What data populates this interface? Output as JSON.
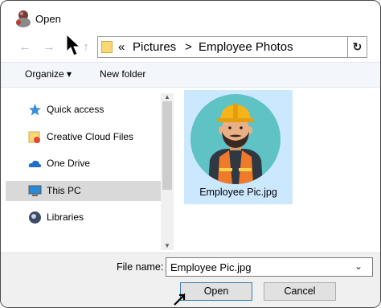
{
  "window": {
    "title": "Open"
  },
  "nav": {
    "back_icon": "arrow-left-icon",
    "forward_icon": "arrow-right-icon",
    "up_icon": "arrow-up-icon",
    "breadcrumb_overflow": "«",
    "crumbs": [
      "Pictures",
      "Employee Photos"
    ],
    "separator": ">",
    "refresh_glyph": "↻"
  },
  "toolbar": {
    "organize_label": "Organize",
    "organize_caret": "▾",
    "new_folder_label": "New folder"
  },
  "sidebar": {
    "items": [
      {
        "label": "Quick access",
        "icon": "star-icon",
        "selected": false
      },
      {
        "label": "Creative Cloud Files",
        "icon": "creative-cloud-folder-icon",
        "selected": false
      },
      {
        "label": "One Drive",
        "icon": "cloud-icon",
        "selected": false
      },
      {
        "label": "This PC",
        "icon": "monitor-icon",
        "selected": true
      },
      {
        "label": "Libraries",
        "icon": "libraries-icon",
        "selected": false
      }
    ]
  },
  "files": [
    {
      "name": "Employee Pic.jpg",
      "thumbnail": "construction-worker-avatar",
      "selected": true
    }
  ],
  "footer": {
    "file_name_label": "File name:",
    "file_name_value": "Employee Pic.jpg",
    "dropdown_glyph": "⌄",
    "open_label": "Open",
    "cancel_label": "Cancel"
  },
  "colors": {
    "selection_blue": "#cce8ff",
    "sidebar_selected": "#d9d9d9",
    "avatar_bg": "#5fc2c4",
    "hard_hat": "#f5b41a",
    "vest": "#f07a2b"
  }
}
